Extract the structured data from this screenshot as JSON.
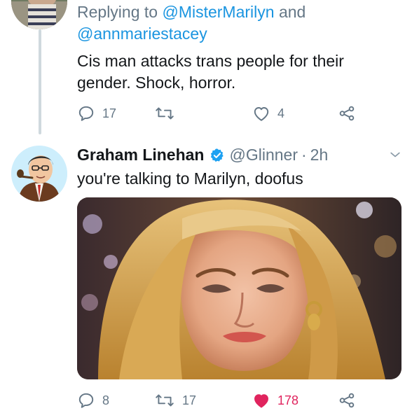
{
  "reply_tweet": {
    "replying_prefix": "Replying to",
    "mention_1": "@MisterMarilyn",
    "and_word": "and",
    "mention_2": "@annmariestacey",
    "text_line_1": "Cis man attacks trans people for their",
    "text_line_2": "gender. Shock, horror.",
    "reply_count": "17",
    "retweet_count": "",
    "like_count": "4"
  },
  "main_tweet": {
    "display_name": "Graham Linehan",
    "handle": "@Glinner",
    "separator": "·",
    "time": "2h",
    "text": "you're talking to Marilyn, doofus",
    "reply_count": "8",
    "retweet_count": "17",
    "like_count": "178",
    "liked": true
  },
  "colors": {
    "link": "#1b95e0",
    "secondary_text": "#657786",
    "like_active": "#e0245e",
    "thread_line": "#cfd9de"
  },
  "icons": [
    "reply-icon",
    "retweet-icon",
    "like-icon",
    "share-icon",
    "verified-badge-icon",
    "chevron-down-icon"
  ]
}
